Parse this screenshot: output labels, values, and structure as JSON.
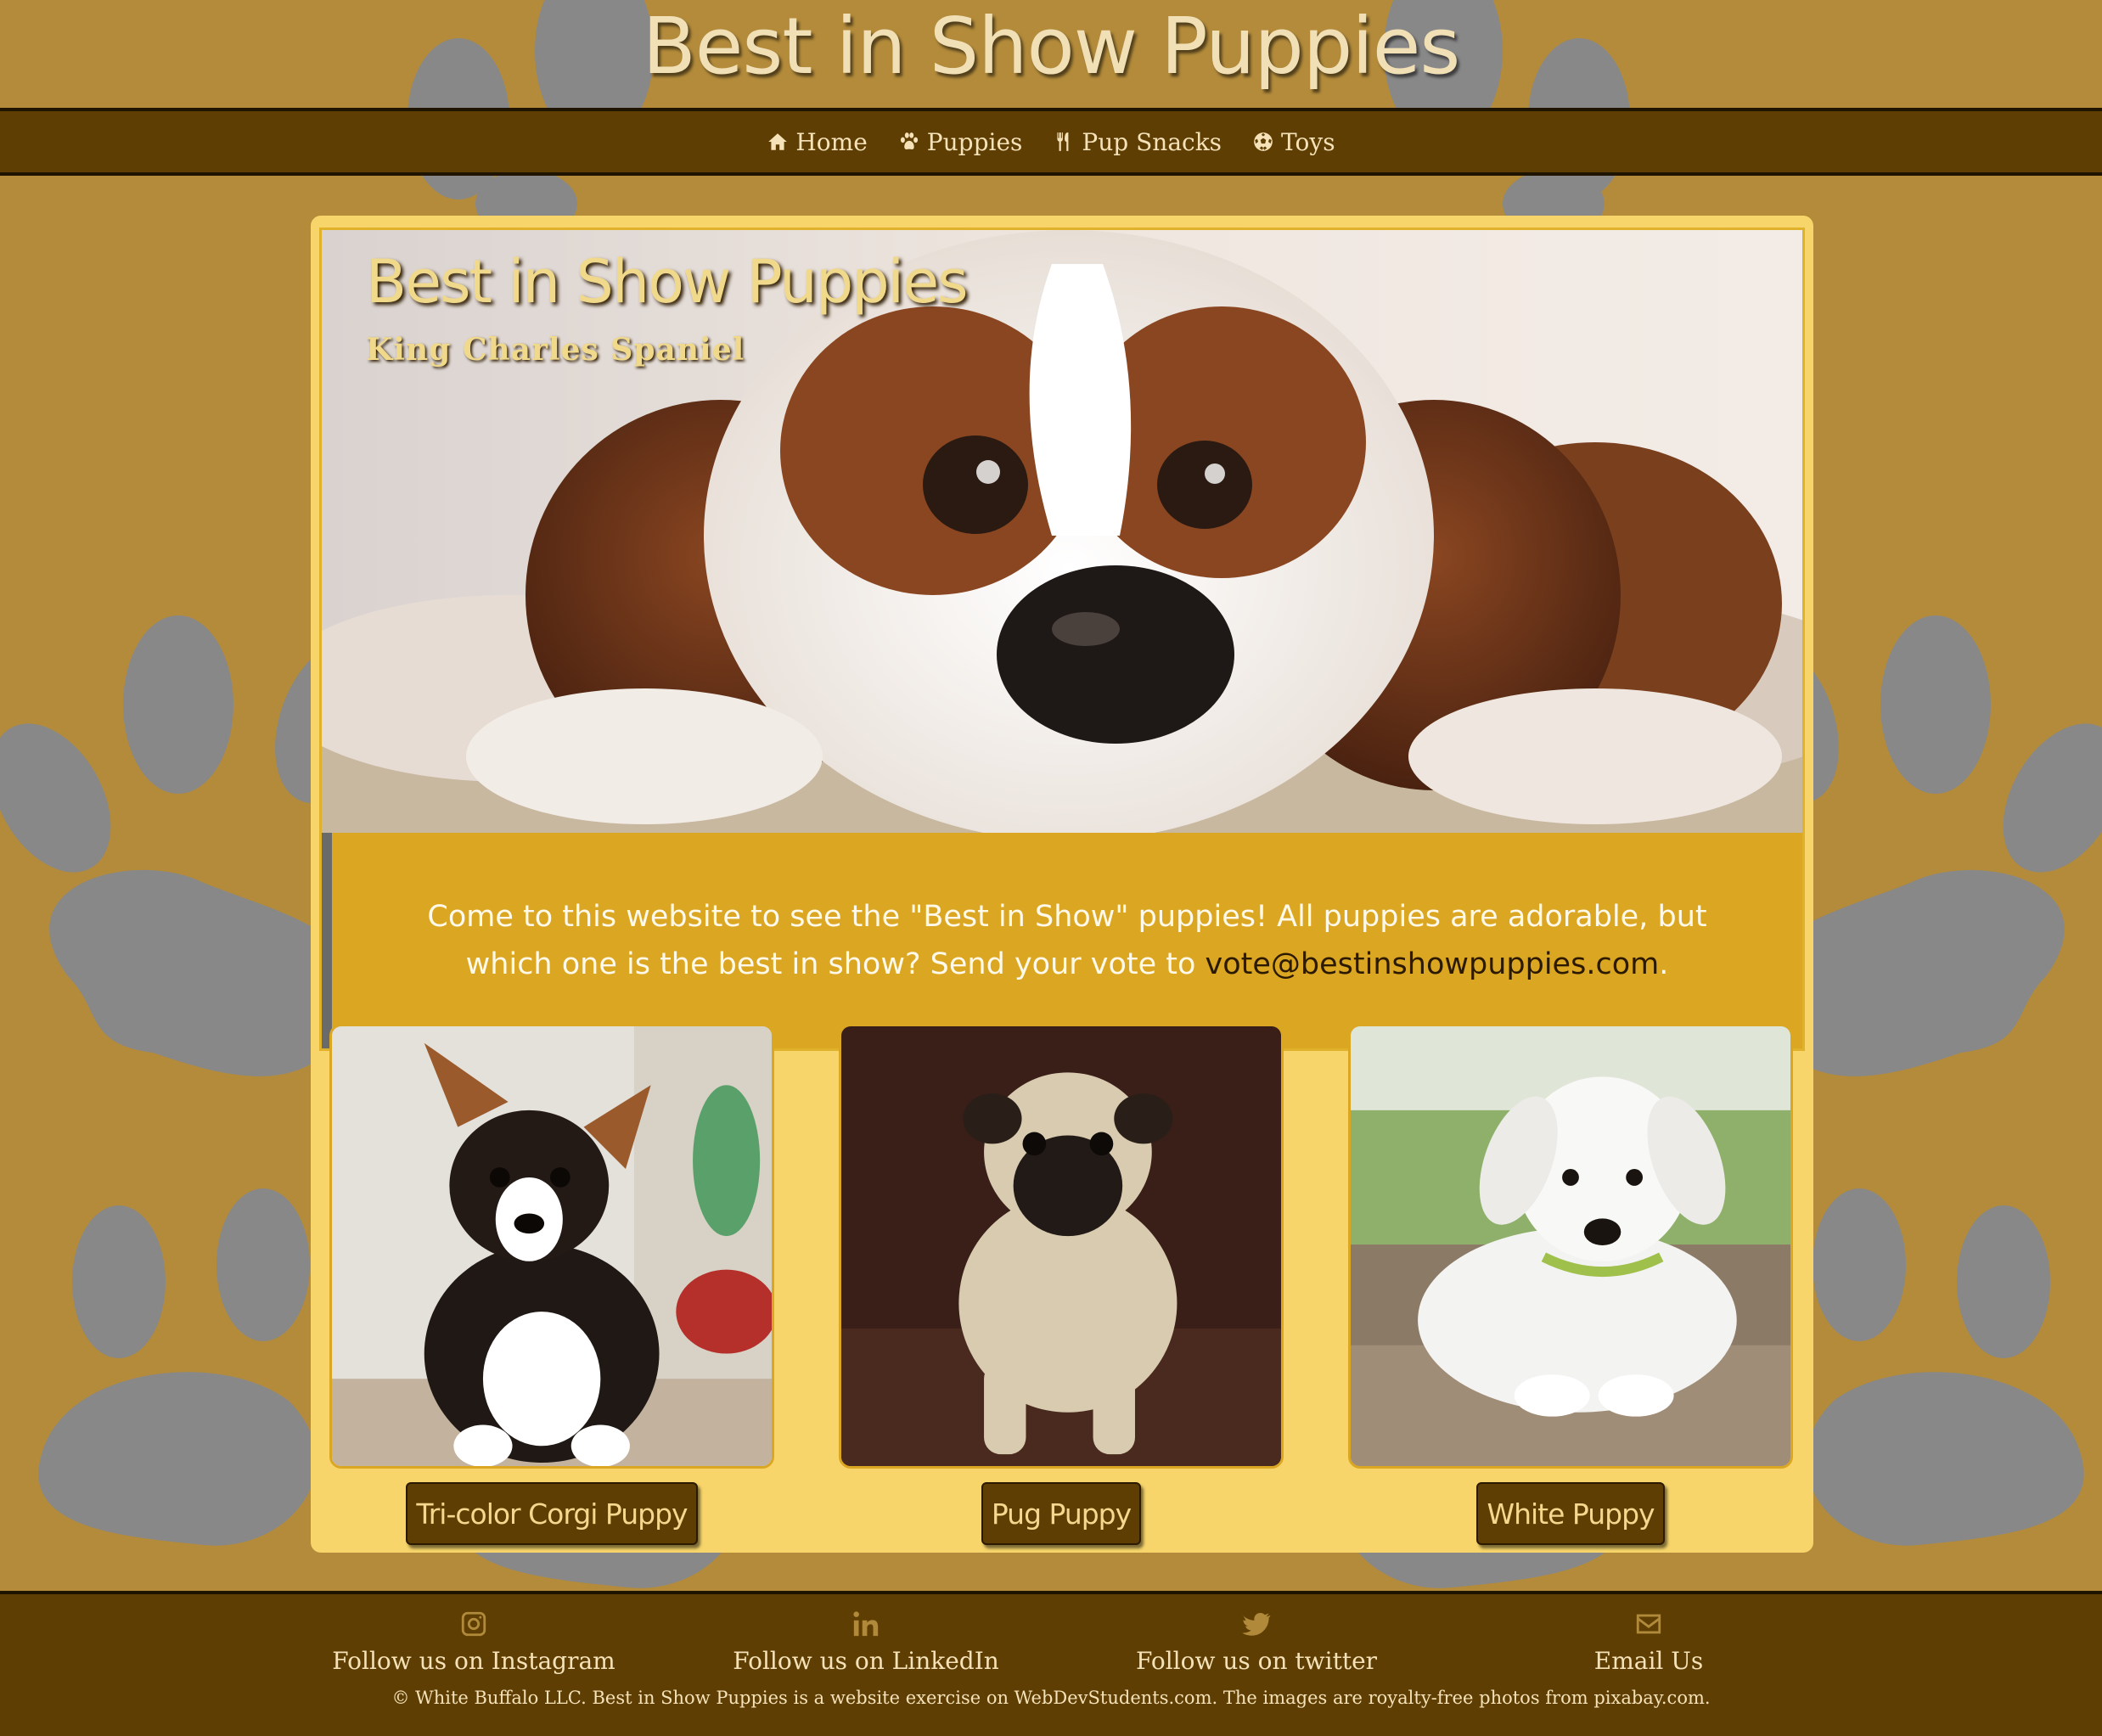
{
  "site": {
    "title": "Best in Show Puppies"
  },
  "nav": {
    "items": [
      {
        "label": "Home",
        "icon": "home-icon"
      },
      {
        "label": "Puppies",
        "icon": "paw-icon"
      },
      {
        "label": "Pup Snacks",
        "icon": "utensils-icon"
      },
      {
        "label": "Toys",
        "icon": "soccer-ball-icon"
      }
    ]
  },
  "hero": {
    "title": "Best in Show Puppies",
    "subtitle": "King Charles Spaniel"
  },
  "intro": {
    "text": "Come to this website to see the \"Best in Show\" puppies! All puppies are adorable, but which one is the best in show? Send your vote to ",
    "email": "vote@bestinshowpuppies.com",
    "suffix": "."
  },
  "puppies": [
    {
      "label": "Tri-color Corgi Puppy"
    },
    {
      "label": "Pug Puppy"
    },
    {
      "label": "White Puppy"
    }
  ],
  "footer": {
    "links": [
      {
        "label": "Follow us on Instagram",
        "icon": "instagram-icon"
      },
      {
        "label": "Follow us on LinkedIn",
        "icon": "linkedin-icon"
      },
      {
        "label": "Follow us on twitter",
        "icon": "twitter-icon"
      },
      {
        "label": "Email Us",
        "icon": "envelope-icon"
      }
    ],
    "copyright": "© White Buffalo LLC. Best in Show Puppies is a website exercise on WebDevStudents.com. The images are royalty-free photos from pixabay.com."
  },
  "colors": {
    "background": "#b38b3b",
    "nav": "#5e3e03",
    "card": "#f7d56b",
    "intro": "#dba622",
    "paw": "#888888"
  }
}
